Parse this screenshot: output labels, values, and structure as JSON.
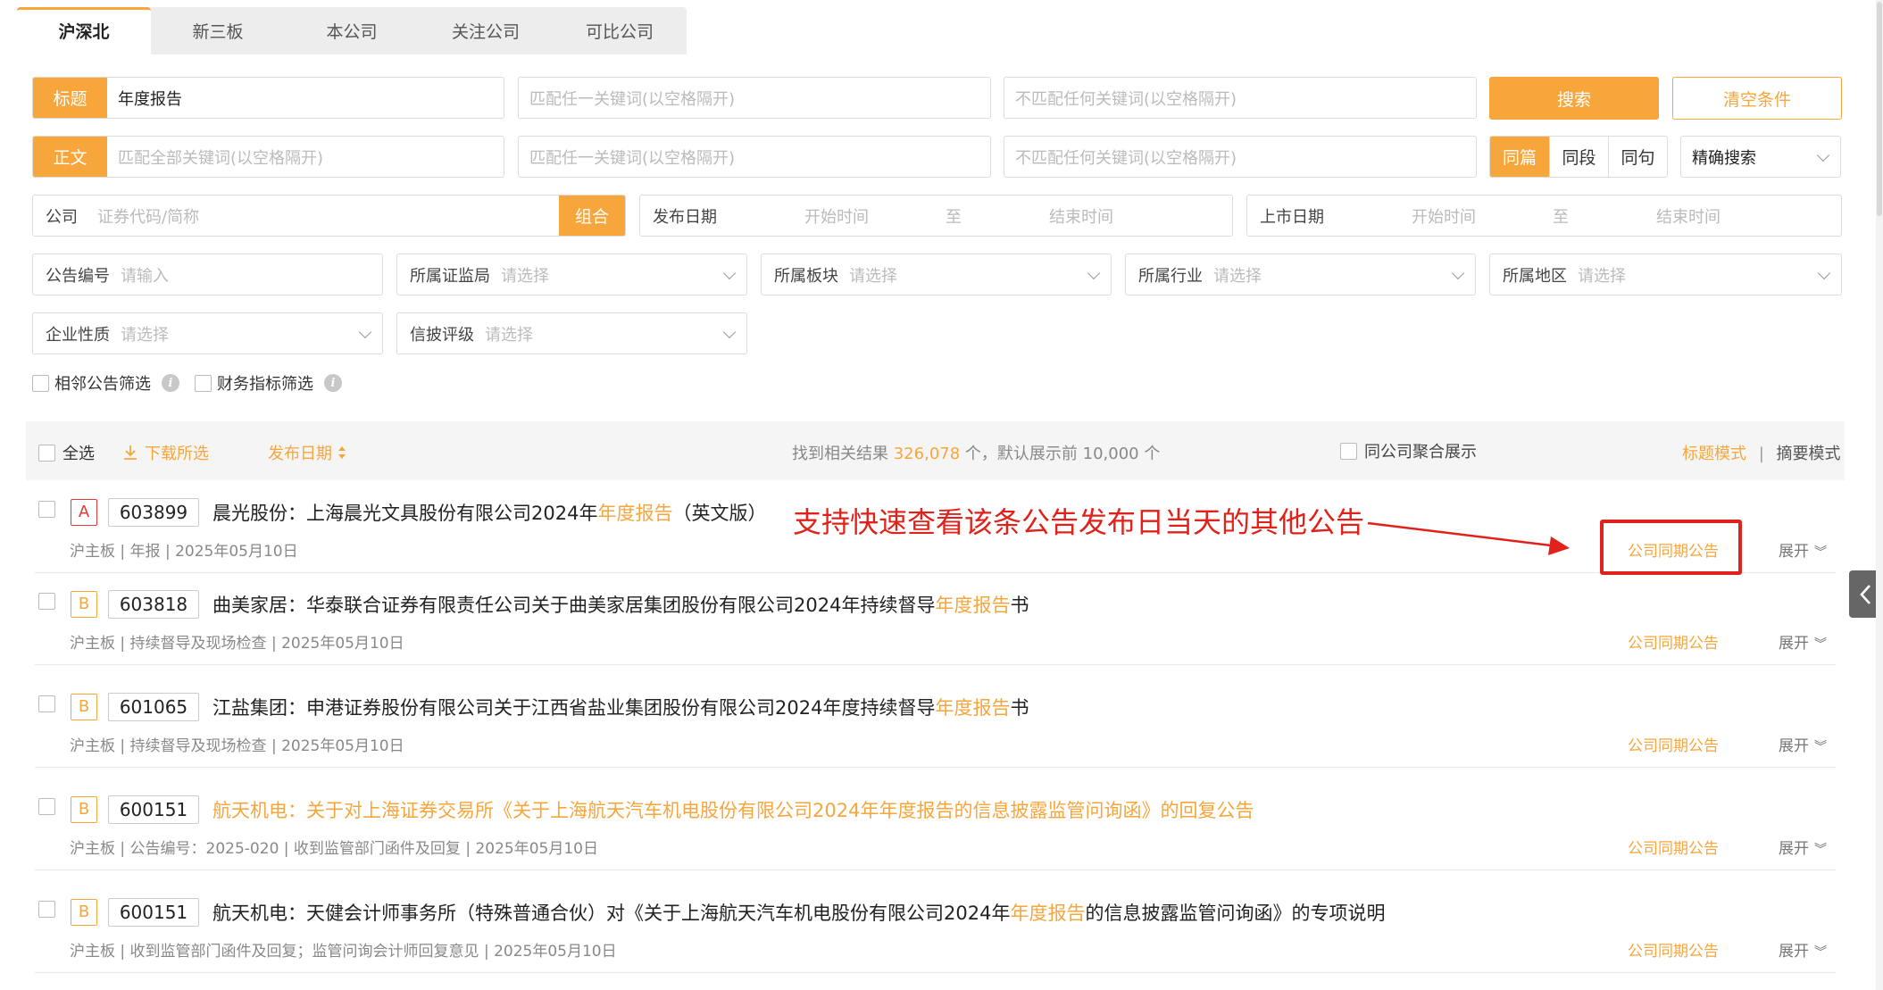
{
  "tabs": [
    "沪深北",
    "新三板",
    "本公司",
    "关注公司",
    "可比公司"
  ],
  "search": {
    "title_tag": "标题",
    "title_value": "年度报告",
    "match_any_placeholder": "匹配任一关键词(以空格隔开)",
    "exclude_placeholder": "不匹配任何关键词(以空格隔开)",
    "body_tag": "正文",
    "body_all_placeholder": "匹配全部关键词(以空格隔开)",
    "search_btn": "搜索",
    "clear_btn": "清空条件",
    "scope_options": [
      "同篇",
      "同段",
      "同句"
    ],
    "precision_select": "精确搜索"
  },
  "filters": {
    "company_label": "公司",
    "company_placeholder": "证券代码/简称",
    "combo_btn": "组合",
    "publish_date_label": "发布日期",
    "list_date_label": "上市日期",
    "start_ph": "开始时间",
    "to": "至",
    "end_ph": "结束时间",
    "ann_no_label": "公告编号",
    "ann_no_ph": "请输入",
    "select_ph": "请选择",
    "regulator_label": "所属证监局",
    "board_label": "所属板块",
    "industry_label": "所属行业",
    "region_label": "所属地区",
    "nature_label": "企业性质",
    "rating_label": "信披评级",
    "adjacent_filter": "相邻公告筛选",
    "finance_filter": "财务指标筛选"
  },
  "results_header": {
    "select_all": "全选",
    "download": "下载所选",
    "sort_date": "发布日期",
    "found_prefix": "找到相关结果",
    "found_count": "326,078",
    "found_suffix": "个，默认展示前 10,000 个",
    "group_display": "同公司聚合展示",
    "title_mode": "标题模式",
    "sep": "|",
    "summary_mode": "摘要模式"
  },
  "annotation": "支持快速查看该条公告发布日当天的其他公告",
  "row_actions": {
    "same_day": "公司同期公告",
    "expand": "展开"
  },
  "rows": [
    {
      "grade": "A",
      "code": "603899",
      "t1": "晨光股份：上海晨光文具股份有限公司2024年",
      "t_hl": "年度报告",
      "t2": "（英文版）",
      "meta": "沪主板 | 年报 | 2025年05月10日",
      "full_hl": false
    },
    {
      "grade": "B",
      "code": "603818",
      "t1": "曲美家居：华泰联合证券有限责任公司关于曲美家居集团股份有限公司2024年持续督导",
      "t_hl": "年度报告",
      "t2": "书",
      "meta": "沪主板 | 持续督导及现场检查 | 2025年05月10日",
      "full_hl": false
    },
    {
      "grade": "B",
      "code": "601065",
      "t1": "江盐集团：申港证券股份有限公司关于江西省盐业集团股份有限公司2024年度持续督导",
      "t_hl": "年度报告",
      "t2": "书",
      "meta": "沪主板 | 持续督导及现场检查 | 2025年05月10日",
      "full_hl": false
    },
    {
      "grade": "B",
      "code": "600151",
      "t1": "航天机电：关于对上海证券交易所《关于上海航天汽车机电股份有限公司2024年年度报告的信息披露监管问询函》的回复公告",
      "t_hl": "",
      "t2": "",
      "meta": "沪主板 | 公告编号：2025-020 | 收到监管部门函件及回复 | 2025年05月10日",
      "full_hl": true
    },
    {
      "grade": "B",
      "code": "600151",
      "t1": "航天机电：天健会计师事务所（特殊普通合伙）对《关于上海航天汽车机电股份有限公司2024年",
      "t_hl": "年度报告",
      "t2": "的信息披露监管问询函》的专项说明",
      "meta": "沪主板 | 收到监管部门函件及回复；监管问询会计师回复意见 | 2025年05月10日",
      "full_hl": false
    }
  ]
}
